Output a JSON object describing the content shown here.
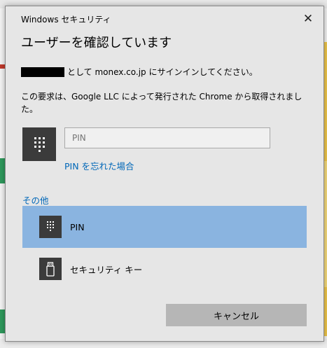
{
  "dialog": {
    "window_title": "Windows セキュリティ",
    "close_glyph": "✕",
    "heading": "ユーザーを確認しています",
    "signin_text": "として monex.co.jp にサインインしてください。",
    "description": "この要求は、Google LLC によって発行された Chrome から取得されました。",
    "pin_placeholder": "PIN",
    "forgot_pin": "PIN を忘れた場合",
    "other_label": "その他",
    "options": [
      {
        "label": "PIN",
        "icon": "keypad-icon",
        "selected": true
      },
      {
        "label": "セキュリティ キー",
        "icon": "usb-key-icon",
        "selected": false
      }
    ],
    "cancel_label": "キャンセル"
  },
  "colors": {
    "accent": "#0067b8",
    "selected_bg": "#8ab4e0",
    "dialog_bg": "#e6e6e6",
    "tile_bg": "#3b3b3b"
  }
}
